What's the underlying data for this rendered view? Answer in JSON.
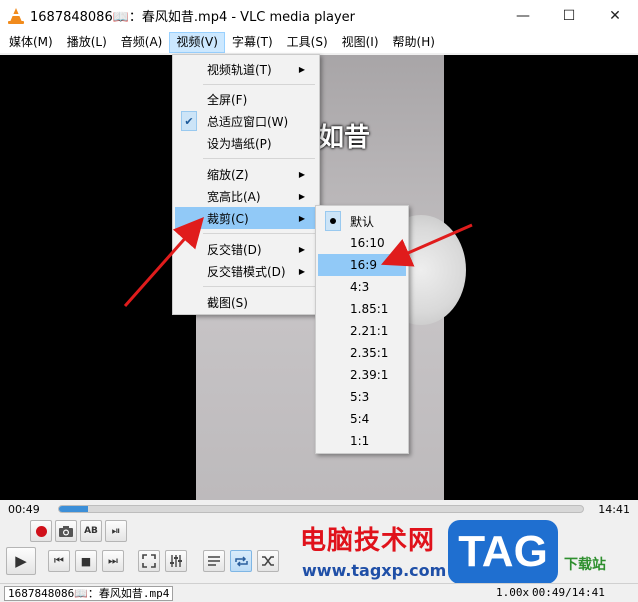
{
  "window": {
    "title": "1687848086📖：春风如昔.mp4 - VLC media player",
    "minimize": "—",
    "maximize": "☐",
    "close": "✕"
  },
  "menubar": {
    "items": [
      {
        "label": "媒体(M)"
      },
      {
        "label": "播放(L)"
      },
      {
        "label": "音频(A)"
      },
      {
        "label": "视频(V)"
      },
      {
        "label": "字幕(T)"
      },
      {
        "label": "工具(S)"
      },
      {
        "label": "视图(I)"
      },
      {
        "label": "帮助(H)"
      }
    ]
  },
  "video": {
    "overlay_text": "如昔"
  },
  "video_menu": {
    "items": [
      {
        "label": "视频轨道(T)"
      },
      {
        "label": "全屏(F)"
      },
      {
        "label": "总适应窗口(W)",
        "checked": "✔"
      },
      {
        "label": "设为墙纸(P)"
      },
      {
        "label": "缩放(Z)"
      },
      {
        "label": "宽高比(A)"
      },
      {
        "label": "裁剪(C)"
      },
      {
        "label": "反交错(D)"
      },
      {
        "label": "反交错模式(D)"
      },
      {
        "label": "截图(S)"
      }
    ],
    "submenu_arrow": "▶"
  },
  "crop_menu": {
    "items": [
      {
        "label": "默认"
      },
      {
        "label": "16:10"
      },
      {
        "label": "16:9"
      },
      {
        "label": "4:3"
      },
      {
        "label": "1.85:1"
      },
      {
        "label": "2.21:1"
      },
      {
        "label": "2.35:1"
      },
      {
        "label": "2.39:1"
      },
      {
        "label": "5:3"
      },
      {
        "label": "5:4"
      },
      {
        "label": "1:1"
      }
    ]
  },
  "controls": {
    "time_elapsed": "00:49",
    "time_total": "14:41",
    "seek_progress": 0.055,
    "buttons": {
      "play": "▶",
      "prev": "⏮",
      "stop": "■",
      "next": "⏭",
      "frame_step": "⏯",
      "ab": "AB"
    }
  },
  "watermark": {
    "cn": "电脑技术网",
    "url": "www.tagxp.com",
    "tag": "TAG",
    "xz": "下载站"
  },
  "statusbar": {
    "file": "1687848086📖：春风如昔.mp4",
    "speed": "1.00x",
    "time": "00:49/14:41"
  },
  "colors": {
    "accent": "#91c9f7",
    "arrow": "#e01c1c",
    "seek_fill": "#3c8fd8"
  }
}
